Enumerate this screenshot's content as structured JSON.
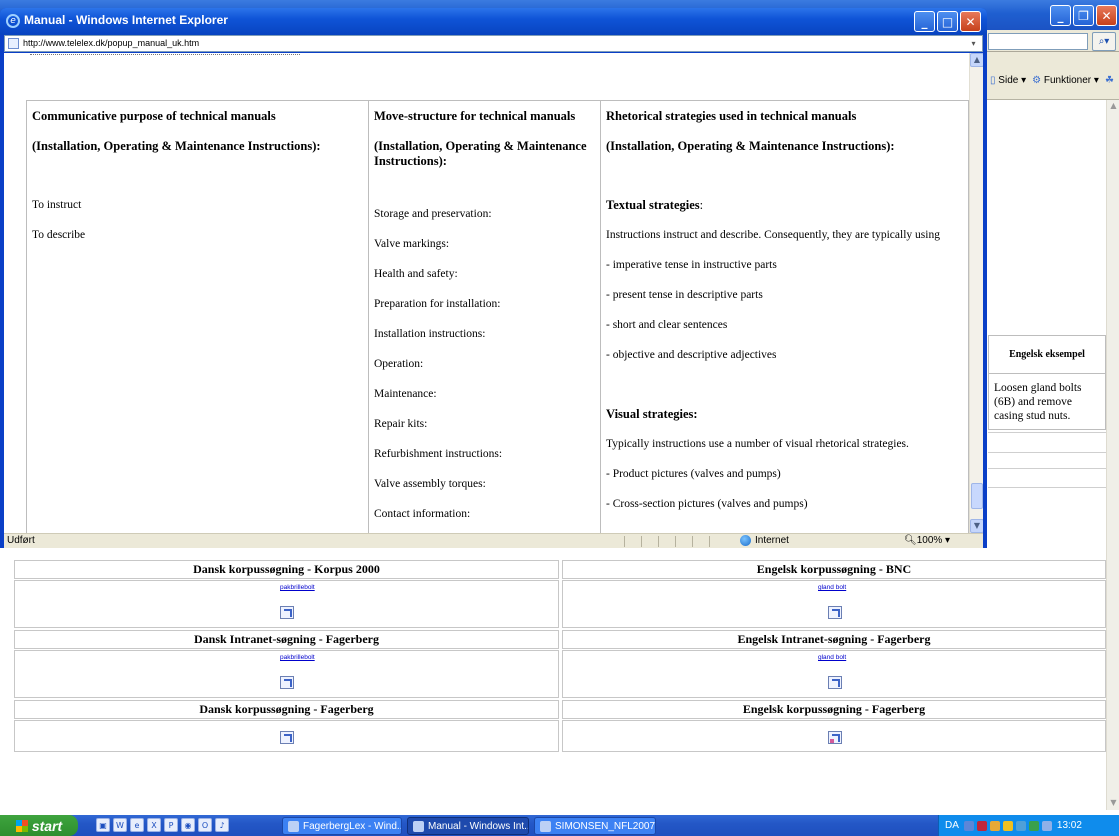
{
  "background_window": {
    "toolbar_side": "Side",
    "toolbar_funktioner": "Funktioner",
    "engelsk_header": "Engelsk eksempel",
    "engelsk_text": "Loosen gland bolts (6B) and remove casing stud nuts."
  },
  "grid": {
    "r1_left_head": "Dansk korpussøgning - Korpus 2000",
    "r1_left_link": "pakbrillebolt",
    "r1_right_head": "Engelsk korpussøgning - BNC",
    "r1_right_link": "gland bolt",
    "r2_left_head": "Dansk Intranet-søgning - Fagerberg",
    "r2_left_link": "pakbrillebolt",
    "r2_right_head": "Engelsk Intranet-søgning - Fagerberg",
    "r2_right_link": "gland bolt",
    "r3_left_head": "Dansk korpussøgning - Fagerberg",
    "r3_right_head": "Engelsk korpussøgning - Fagerberg"
  },
  "popup": {
    "title": "Manual - Windows Internet Explorer",
    "address": "http://www.telelex.dk/popup_manual_uk.htm",
    "status_ready": "Udført",
    "status_zone": "Internet",
    "status_zoom": "100%",
    "col1": {
      "heading": "Communicative purpose of technical manuals",
      "subheading": "(Installation, Operating & Maintenance Instructions):",
      "items": [
        "To instruct",
        "To describe"
      ]
    },
    "col2": {
      "heading": "Move-structure for technical manuals",
      "subheading": "(Installation, Operating & Maintenance Instructions):",
      "items": [
        "Storage and preservation:",
        "Valve markings:",
        "Health and safety:",
        "Preparation for installation:",
        "Installation instructions:",
        "Operation:",
        "Maintenance:",
        "Repair kits:",
        "Refurbishment instructions:",
        "Valve assembly torques:",
        "Contact information:"
      ]
    },
    "col3": {
      "heading": "Rhetorical strategies used in technical manuals",
      "subheading": "(Installation, Operating & Maintenance Instructions):",
      "textual_heading": "Textual strategies",
      "textual_colon": ":",
      "textual_items": [
        "Instructions instruct and describe. Consequently, they are typically using",
        "- imperative tense in instructive parts",
        "-  present tense in descriptive parts",
        "- short and clear sentences",
        "- objective and descriptive adjectives"
      ],
      "visual_heading": "Visual strategies:",
      "visual_items": [
        "Typically instructions use a number of visual rhetorical strategies.",
        "- Product pictures (valves and pumps)",
        "- Cross-section pictures (valves and pumps)"
      ]
    }
  },
  "taskbar": {
    "start": "start",
    "task1": "FagerbergLex - Wind...",
    "task2": "Manual - Windows Int...",
    "task3": "SIMONSEN_NFL2007....",
    "lang": "DA",
    "clock": "13:02"
  }
}
